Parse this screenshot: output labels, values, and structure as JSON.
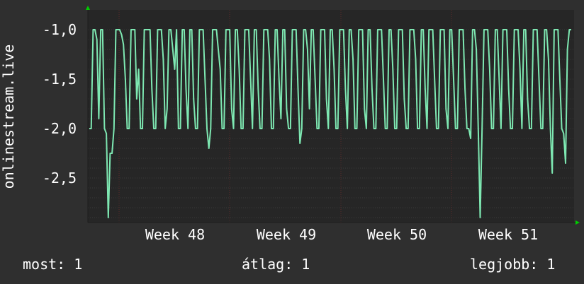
{
  "chart_data": {
    "type": "line",
    "ylabel": "onlinestream.live",
    "ylim": [
      -2.95,
      -0.8
    ],
    "yticks": [
      {
        "value": -1.0,
        "label": "-1,0"
      },
      {
        "value": -1.5,
        "label": "-1,5"
      },
      {
        "value": -2.0,
        "label": "-2,0"
      },
      {
        "value": -2.5,
        "label": "-2,5"
      }
    ],
    "xticks": [
      "Week 48",
      "Week 49",
      "Week 50",
      "Week 51"
    ],
    "series": [
      {
        "values": [
          -2.0,
          -2.0,
          -1.0,
          -1.0,
          -1.1,
          -1.9,
          -1.0,
          -1.0,
          -2.0,
          -2.05,
          -2.9,
          -2.25,
          -2.25,
          -2.0,
          -1.0,
          -1.0,
          -1.0,
          -1.05,
          -1.15,
          -1.5,
          -2.0,
          -2.0,
          -1.0,
          -1.0,
          -1.0,
          -1.7,
          -1.4,
          -2.0,
          -2.0,
          -1.0,
          -1.0,
          -1.0,
          -1.0,
          -1.6,
          -2.0,
          -2.0,
          -1.0,
          -1.0,
          -1.0,
          -1.3,
          -2.0,
          -1.8,
          -1.0,
          -1.0,
          -1.2,
          -1.4,
          -1.0,
          -2.0,
          -2.0,
          -1.0,
          -1.0,
          -1.6,
          -2.0,
          -1.0,
          -1.0,
          -1.7,
          -2.0,
          -2.0,
          -1.0,
          -1.0,
          -1.0,
          -1.5,
          -2.0,
          -2.2,
          -2.0,
          -1.0,
          -1.0,
          -1.0,
          -1.2,
          -1.4,
          -2.0,
          -2.0,
          -1.0,
          -1.0,
          -1.0,
          -1.8,
          -2.0,
          -1.0,
          -1.0,
          -1.4,
          -2.0,
          -2.0,
          -1.0,
          -1.0,
          -1.0,
          -1.5,
          -2.0,
          -1.0,
          -1.0,
          -1.6,
          -2.0,
          -2.0,
          -1.0,
          -1.0,
          -1.0,
          -1.3,
          -2.0,
          -2.0,
          -1.0,
          -1.0,
          -1.5,
          -1.9,
          -1.0,
          -1.0,
          -1.8,
          -2.0,
          -2.0,
          -1.0,
          -1.0,
          -1.0,
          -1.6,
          -2.15,
          -2.0,
          -1.0,
          -1.0,
          -1.2,
          -1.8,
          -1.0,
          -1.0,
          -1.5,
          -2.0,
          -2.0,
          -1.0,
          -1.0,
          -1.0,
          -1.7,
          -2.0,
          -1.0,
          -1.0,
          -1.4,
          -2.0,
          -2.0,
          -1.0,
          -1.0,
          -1.0,
          -1.6,
          -2.0,
          -1.0,
          -1.0,
          -1.3,
          -2.0,
          -2.0,
          -1.0,
          -1.0,
          -1.0,
          -1.8,
          -2.0,
          -1.0,
          -1.0,
          -1.6,
          -2.0,
          -2.0,
          -1.0,
          -1.0,
          -1.0,
          -1.5,
          -2.0,
          -2.0,
          -1.0,
          -1.0,
          -1.4,
          -2.0,
          -2.0,
          -1.0,
          -1.0,
          -1.0,
          -1.7,
          -2.0,
          -2.0,
          -1.0,
          -1.0,
          -1.0,
          -1.3,
          -2.0,
          -2.0,
          -1.0,
          -1.0,
          -1.6,
          -2.0,
          -1.0,
          -1.0,
          -1.0,
          -1.5,
          -2.0,
          -2.0,
          -1.0,
          -1.0,
          -1.0,
          -1.8,
          -2.0,
          -1.0,
          -1.0,
          -1.5,
          -2.0,
          -2.0,
          -1.0,
          -1.0,
          -1.0,
          -1.6,
          -2.0,
          -2.0,
          -2.1,
          -1.0,
          -1.0,
          -1.2,
          -2.0,
          -2.9,
          -2.0,
          -1.0,
          -1.0,
          -1.0,
          -1.4,
          -2.0,
          -2.0,
          -1.0,
          -1.0,
          -1.5,
          -2.0,
          -1.0,
          -1.0,
          -1.0,
          -1.6,
          -2.0,
          -2.0,
          -1.0,
          -1.0,
          -1.0,
          -1.4,
          -2.0,
          -1.0,
          -1.0,
          -1.7,
          -2.0,
          -2.0,
          -1.0,
          -1.0,
          -1.0,
          -1.5,
          -2.0,
          -2.0,
          -1.0,
          -1.0,
          -1.3,
          -2.0,
          -2.45,
          -1.0,
          -1.0,
          -1.0,
          -1.5,
          -2.0,
          -2.05,
          -2.35,
          -1.2,
          -1.0,
          -1.0
        ]
      }
    ],
    "colors": {
      "line": "#7ee8b2",
      "plot_bg": "#262626",
      "grid": "#3a3a3a",
      "axis": "#1e1e1e",
      "arrow": "#00cc00"
    }
  },
  "legend": {
    "now": "most: 1",
    "avg": "átlag: 1",
    "max": "legjobb: 1"
  }
}
